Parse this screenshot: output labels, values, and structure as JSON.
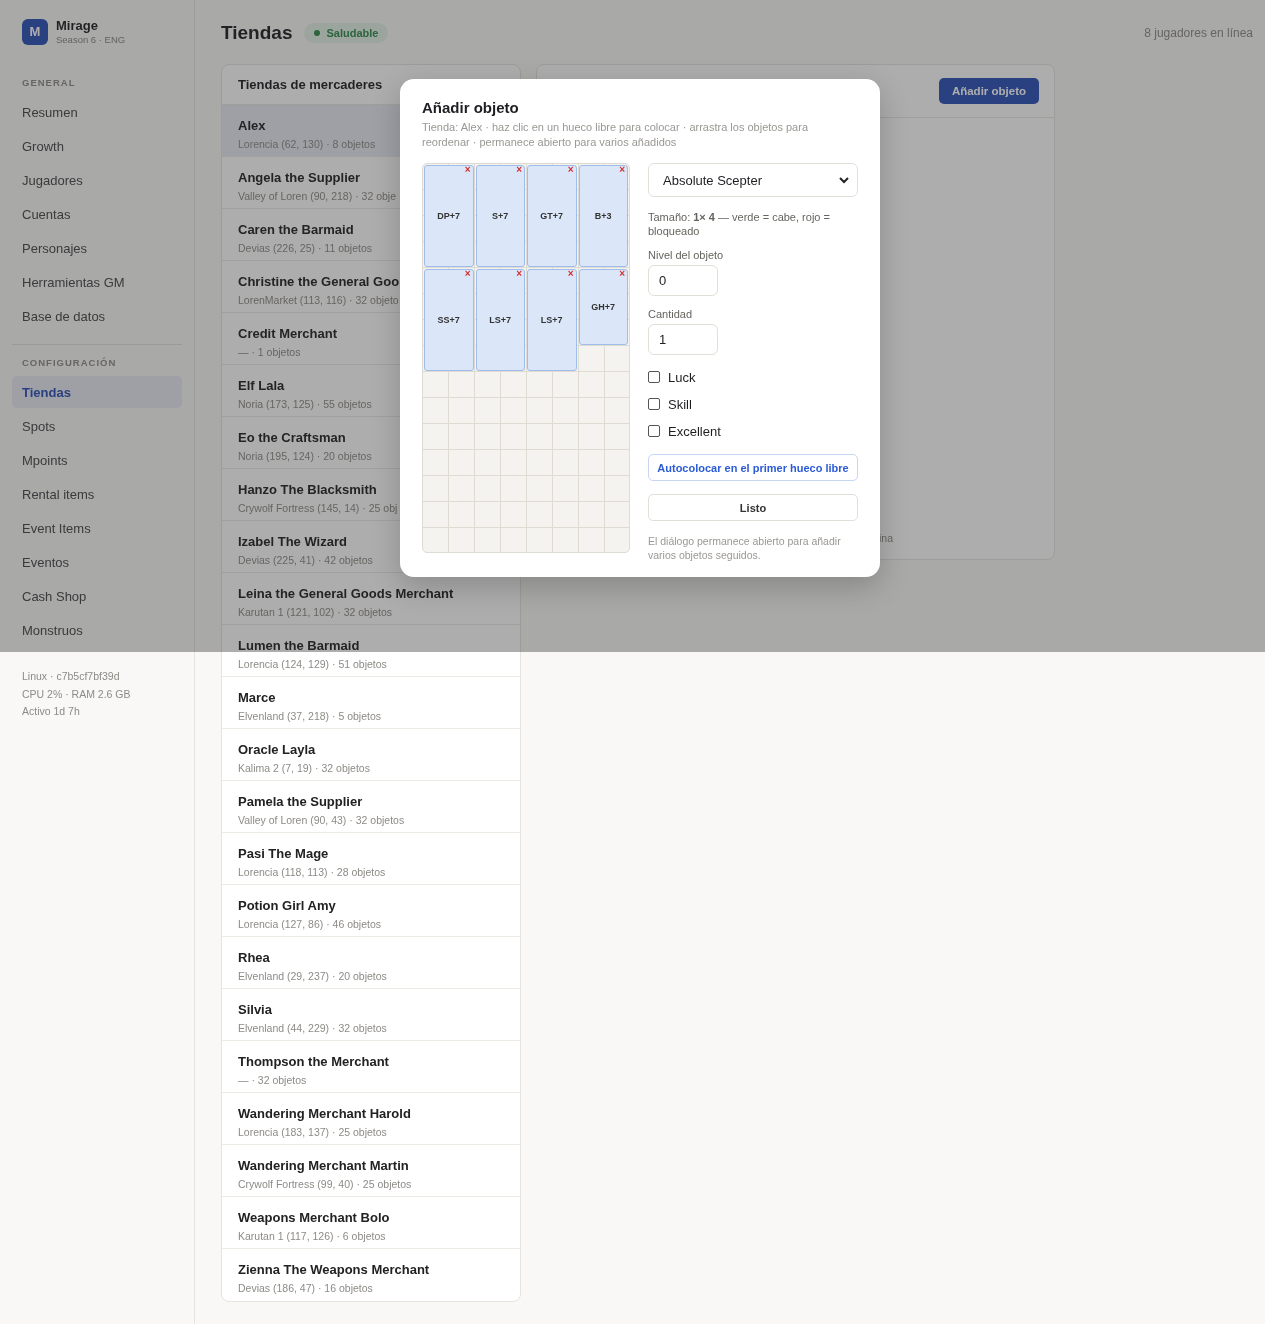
{
  "brand": {
    "logo": "M",
    "name": "Mirage",
    "subtitle": "Season 6 · ENG"
  },
  "sidebar": {
    "sections": [
      {
        "title": "GENERAL",
        "items": [
          {
            "label": "Resumen",
            "selected": false
          },
          {
            "label": "Growth",
            "selected": false
          },
          {
            "label": "Jugadores",
            "selected": false
          },
          {
            "label": "Cuentas",
            "selected": false
          },
          {
            "label": "Personajes",
            "selected": false
          },
          {
            "label": "Herramientas GM",
            "selected": false
          },
          {
            "label": "Base de datos",
            "selected": false
          }
        ]
      },
      {
        "title": "CONFIGURACIÓN",
        "items": [
          {
            "label": "Tiendas",
            "selected": true
          },
          {
            "label": "Spots",
            "selected": false
          },
          {
            "label": "Mpoints",
            "selected": false
          },
          {
            "label": "Rental items",
            "selected": false
          },
          {
            "label": "Event Items",
            "selected": false
          },
          {
            "label": "Eventos",
            "selected": false
          },
          {
            "label": "Cash Shop",
            "selected": false
          },
          {
            "label": "Monstruos",
            "selected": false
          }
        ]
      }
    ],
    "footer": [
      "Linux · c7b5cf7bf39d",
      "CPU 2% · RAM 2.6 GB",
      "Activo 1d 7h"
    ]
  },
  "header": {
    "title": "Tiendas",
    "status": "Saludable",
    "players": "8 jugadores en línea"
  },
  "shop_list": {
    "title": "Tiendas de mercaderes",
    "rows": [
      {
        "name": "Alex",
        "detail": "Lorencia (62, 130) · 8 objetos",
        "selected": true
      },
      {
        "name": "Angela the Supplier",
        "detail": "Valley of Loren (90, 218) · 32 obje",
        "selected": false
      },
      {
        "name": "Caren the Barmaid",
        "detail": "Devias (226, 25) · 11 objetos",
        "selected": false
      },
      {
        "name": "Christine the General Goo",
        "detail": "LorenMarket (113, 116) · 32 objeto",
        "selected": false
      },
      {
        "name": "Credit Merchant",
        "detail": "— · 1 objetos",
        "selected": false
      },
      {
        "name": "Elf Lala",
        "detail": "Noria (173, 125) · 55 objetos",
        "selected": false
      },
      {
        "name": "Eo the Craftsman",
        "detail": "Noria (195, 124) · 20 objetos",
        "selected": false
      },
      {
        "name": "Hanzo The Blacksmith",
        "detail": "Crywolf Fortress (145, 14) · 25 obj",
        "selected": false
      },
      {
        "name": "Izabel The Wizard",
        "detail": "Devias (225, 41) · 42 objetos",
        "selected": false
      },
      {
        "name": "Leina the General Goods Merchant",
        "detail": "Karutan 1 (121, 102) · 32 objetos",
        "selected": false
      },
      {
        "name": "Lumen the Barmaid",
        "detail": "Lorencia (124, 129) · 51 objetos",
        "selected": false
      },
      {
        "name": "Marce",
        "detail": "Elvenland (37, 218) · 5 objetos",
        "selected": false
      },
      {
        "name": "Oracle Layla",
        "detail": "Kalima 2 (7, 19) · 32 objetos",
        "selected": false
      },
      {
        "name": "Pamela the Supplier",
        "detail": "Valley of Loren (90, 43) · 32 objetos",
        "selected": false
      },
      {
        "name": "Pasi The Mage",
        "detail": "Lorencia (118, 113) · 28 objetos",
        "selected": false
      },
      {
        "name": "Potion Girl Amy",
        "detail": "Lorencia (127, 86) · 46 objetos",
        "selected": false
      },
      {
        "name": "Rhea",
        "detail": "Elvenland (29, 237) · 20 objetos",
        "selected": false
      },
      {
        "name": "Silvia",
        "detail": "Elvenland (44, 229) · 32 objetos",
        "selected": false
      },
      {
        "name": "Thompson the Merchant",
        "detail": "— · 32 objetos",
        "selected": false
      },
      {
        "name": "Wandering Merchant Harold",
        "detail": "Lorencia (183, 137) · 25 objetos",
        "selected": false
      },
      {
        "name": "Wandering Merchant Martin",
        "detail": "Crywolf Fortress (99, 40) · 25 objetos",
        "selected": false
      },
      {
        "name": "Weapons Merchant Bolo",
        "detail": "Karutan 1 (117, 126) · 6 objetos",
        "selected": false
      },
      {
        "name": "Zienna The Weapons Merchant",
        "detail": "Devias (186, 47) · 16 objetos",
        "selected": false
      }
    ]
  },
  "detail_panel": {
    "add_button": "Añadir objeto",
    "note_tail": "ina"
  },
  "dialog": {
    "title": "Añadir objeto",
    "subtitle": "Tienda: Alex · haz clic en un hueco libre para colocar · arrastra los objetos para reordenar · permanece abierto para varios añadidos",
    "items": [
      {
        "label": "DP+7",
        "kind": "long"
      },
      {
        "label": "S+7",
        "kind": "long"
      },
      {
        "label": "GT+7",
        "kind": "long"
      },
      {
        "label": "B+3",
        "kind": "long"
      },
      {
        "label": "SS+7",
        "kind": "long"
      },
      {
        "label": "LS+7",
        "kind": "long"
      },
      {
        "label": "LS+7",
        "kind": "long"
      },
      {
        "label": "GH+7",
        "kind": "short"
      }
    ],
    "remove_mark": "×",
    "item_select": {
      "value": "Absolute Scepter"
    },
    "size_hint": "Tamaño: **1× 4** — verde = cabe, rojo = bloqueado",
    "fields": [
      {
        "label": "Nivel del objeto",
        "value": "0"
      },
      {
        "label": "Cantidad",
        "value": "1"
      }
    ],
    "options": [
      {
        "label": "Luck",
        "checked": false
      },
      {
        "label": "Skill",
        "checked": false
      },
      {
        "label": "Excellent",
        "checked": false
      }
    ],
    "autoplace_button": "Autocolocar en el primer hueco libre",
    "done_button": "Listo",
    "note": "El diálogo permanece abierto para añadir varios objetos seguidos."
  }
}
